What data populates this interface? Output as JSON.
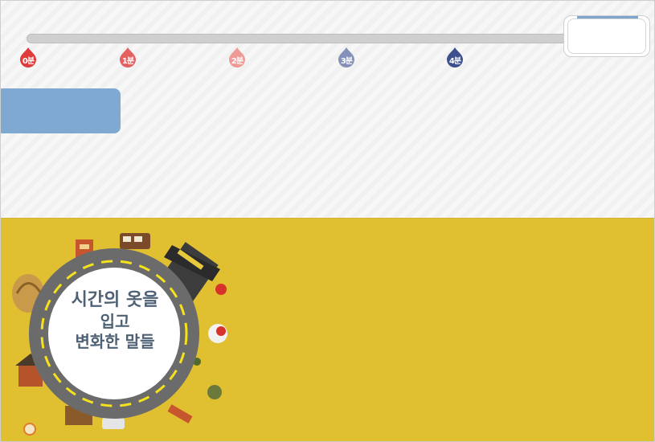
{
  "timeline": {
    "markers": [
      {
        "label": "0분",
        "color": "#e03b3b"
      },
      {
        "label": "1분",
        "color": "#e56060"
      },
      {
        "label": "2분",
        "color": "#ee9a96"
      },
      {
        "label": "3분",
        "color": "#8590b8"
      },
      {
        "label": "4분",
        "color": "#3d4f8c"
      }
    ]
  },
  "colors": {
    "accent_blue": "#80a9d2",
    "panel_yellow": "#e0bf30",
    "title_text": "#4f6275"
  },
  "title": {
    "line1": "시간의 옷을",
    "line2": "입고",
    "line3": "변화한 말들"
  },
  "icons": {
    "marker": "drop-pin-icon",
    "illustration": "city-road-circle-illustration"
  }
}
